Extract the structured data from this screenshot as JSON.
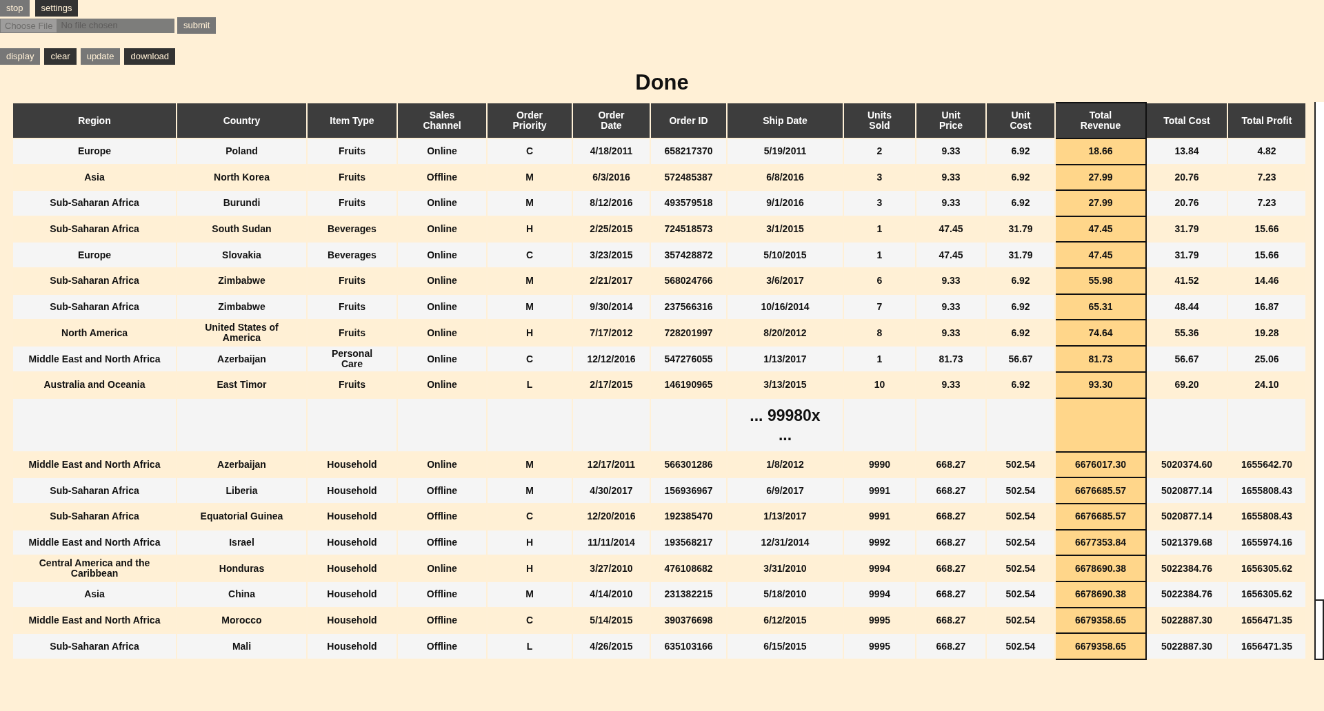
{
  "toolbar_top": [
    {
      "label": "stop",
      "kind": "light"
    },
    {
      "label": "settings",
      "kind": "dark"
    }
  ],
  "file_input": {
    "button": "Choose File",
    "status": "No file chosen",
    "disabled": true
  },
  "submit": {
    "label": "submit",
    "kind": "light"
  },
  "toolbar_actions": [
    {
      "label": "display",
      "kind": "light"
    },
    {
      "label": "clear",
      "kind": "dark"
    },
    {
      "label": "update",
      "kind": "light"
    },
    {
      "label": "download",
      "kind": "dark"
    }
  ],
  "title": "Done",
  "table": {
    "columns": [
      {
        "label": "Region",
        "highlighted": false
      },
      {
        "label": "Country",
        "highlighted": false
      },
      {
        "label": "Item Type",
        "highlighted": false
      },
      {
        "label": "Sales Channel",
        "highlighted": false
      },
      {
        "label": "Order Priority",
        "highlighted": false
      },
      {
        "label": "Order Date",
        "highlighted": false
      },
      {
        "label": "Order ID",
        "highlighted": false
      },
      {
        "label": "Ship Date",
        "highlighted": false
      },
      {
        "label": "Units Sold",
        "highlighted": false
      },
      {
        "label": "Unit Price",
        "highlighted": false
      },
      {
        "label": "Unit Cost",
        "highlighted": false
      },
      {
        "label": "Total Revenue",
        "highlighted": true
      },
      {
        "label": "Total Cost",
        "highlighted": false
      },
      {
        "label": "Total Profit",
        "highlighted": false
      }
    ],
    "rows": [
      {
        "kind": "data",
        "cells": [
          "Europe",
          "Poland",
          "Fruits",
          "Online",
          "C",
          "4/18/2011",
          "658217370",
          "5/19/2011",
          "2",
          "9.33",
          "6.92",
          "18.66",
          "13.84",
          "4.82"
        ]
      },
      {
        "kind": "data",
        "cells": [
          "Asia",
          "North Korea",
          "Fruits",
          "Offline",
          "M",
          "6/3/2016",
          "572485387",
          "6/8/2016",
          "3",
          "9.33",
          "6.92",
          "27.99",
          "20.76",
          "7.23"
        ]
      },
      {
        "kind": "data",
        "cells": [
          "Sub-Saharan Africa",
          "Burundi",
          "Fruits",
          "Online",
          "M",
          "8/12/2016",
          "493579518",
          "9/1/2016",
          "3",
          "9.33",
          "6.92",
          "27.99",
          "20.76",
          "7.23"
        ]
      },
      {
        "kind": "data",
        "cells": [
          "Sub-Saharan Africa",
          "South Sudan",
          "Beverages",
          "Online",
          "H",
          "2/25/2015",
          "724518573",
          "3/1/2015",
          "1",
          "47.45",
          "31.79",
          "47.45",
          "31.79",
          "15.66"
        ]
      },
      {
        "kind": "data",
        "cells": [
          "Europe",
          "Slovakia",
          "Beverages",
          "Online",
          "C",
          "3/23/2015",
          "357428872",
          "5/10/2015",
          "1",
          "47.45",
          "31.79",
          "47.45",
          "31.79",
          "15.66"
        ]
      },
      {
        "kind": "data",
        "cells": [
          "Sub-Saharan Africa",
          "Zimbabwe",
          "Fruits",
          "Online",
          "M",
          "2/21/2017",
          "568024766",
          "3/6/2017",
          "6",
          "9.33",
          "6.92",
          "55.98",
          "41.52",
          "14.46"
        ]
      },
      {
        "kind": "data",
        "cells": [
          "Sub-Saharan Africa",
          "Zimbabwe",
          "Fruits",
          "Online",
          "M",
          "9/30/2014",
          "237566316",
          "10/16/2014",
          "7",
          "9.33",
          "6.92",
          "65.31",
          "48.44",
          "16.87"
        ]
      },
      {
        "kind": "data",
        "cells": [
          "North America",
          "United States of America",
          "Fruits",
          "Online",
          "H",
          "7/17/2012",
          "728201997",
          "8/20/2012",
          "8",
          "9.33",
          "6.92",
          "74.64",
          "55.36",
          "19.28"
        ]
      },
      {
        "kind": "data",
        "cells": [
          "Middle East and North Africa",
          "Azerbaijan",
          "Personal Care",
          "Online",
          "C",
          "12/12/2016",
          "547276055",
          "1/13/2017",
          "1",
          "81.73",
          "56.67",
          "81.73",
          "56.67",
          "25.06"
        ]
      },
      {
        "kind": "data",
        "cells": [
          "Australia and Oceania",
          "East Timor",
          "Fruits",
          "Online",
          "L",
          "2/17/2015",
          "146190965",
          "3/13/2015",
          "10",
          "9.33",
          "6.92",
          "93.30",
          "69.20",
          "24.10"
        ]
      },
      {
        "kind": "gap",
        "text": "... 99980x ..."
      },
      {
        "kind": "data",
        "cells": [
          "Middle East and North Africa",
          "Azerbaijan",
          "Household",
          "Online",
          "M",
          "12/17/2011",
          "566301286",
          "1/8/2012",
          "9990",
          "668.27",
          "502.54",
          "6676017.30",
          "5020374.60",
          "1655642.70"
        ]
      },
      {
        "kind": "data",
        "cells": [
          "Sub-Saharan Africa",
          "Liberia",
          "Household",
          "Offline",
          "M",
          "4/30/2017",
          "156936967",
          "6/9/2017",
          "9991",
          "668.27",
          "502.54",
          "6676685.57",
          "5020877.14",
          "1655808.43"
        ]
      },
      {
        "kind": "data",
        "cells": [
          "Sub-Saharan Africa",
          "Equatorial Guinea",
          "Household",
          "Offline",
          "C",
          "12/20/2016",
          "192385470",
          "1/13/2017",
          "9991",
          "668.27",
          "502.54",
          "6676685.57",
          "5020877.14",
          "1655808.43"
        ]
      },
      {
        "kind": "data",
        "cells": [
          "Middle East and North Africa",
          "Israel",
          "Household",
          "Offline",
          "H",
          "11/11/2014",
          "193568217",
          "12/31/2014",
          "9992",
          "668.27",
          "502.54",
          "6677353.84",
          "5021379.68",
          "1655974.16"
        ]
      },
      {
        "kind": "data",
        "cells": [
          "Central America and the Caribbean",
          "Honduras",
          "Household",
          "Online",
          "H",
          "3/27/2010",
          "476108682",
          "3/31/2010",
          "9994",
          "668.27",
          "502.54",
          "6678690.38",
          "5022384.76",
          "1656305.62"
        ]
      },
      {
        "kind": "data",
        "cells": [
          "Asia",
          "China",
          "Household",
          "Offline",
          "M",
          "4/14/2010",
          "231382215",
          "5/18/2010",
          "9994",
          "668.27",
          "502.54",
          "6678690.38",
          "5022384.76",
          "1656305.62"
        ]
      },
      {
        "kind": "data",
        "cells": [
          "Middle East and North Africa",
          "Morocco",
          "Household",
          "Offline",
          "C",
          "5/14/2015",
          "390376698",
          "6/12/2015",
          "9995",
          "668.27",
          "502.54",
          "6679358.65",
          "5022887.30",
          "1656471.35"
        ]
      },
      {
        "kind": "data",
        "cells": [
          "Sub-Saharan Africa",
          "Mali",
          "Household",
          "Offline",
          "L",
          "4/26/2015",
          "635103166",
          "6/15/2015",
          "9995",
          "668.27",
          "502.54",
          "6679358.65",
          "5022887.30",
          "1656471.35"
        ]
      }
    ]
  }
}
